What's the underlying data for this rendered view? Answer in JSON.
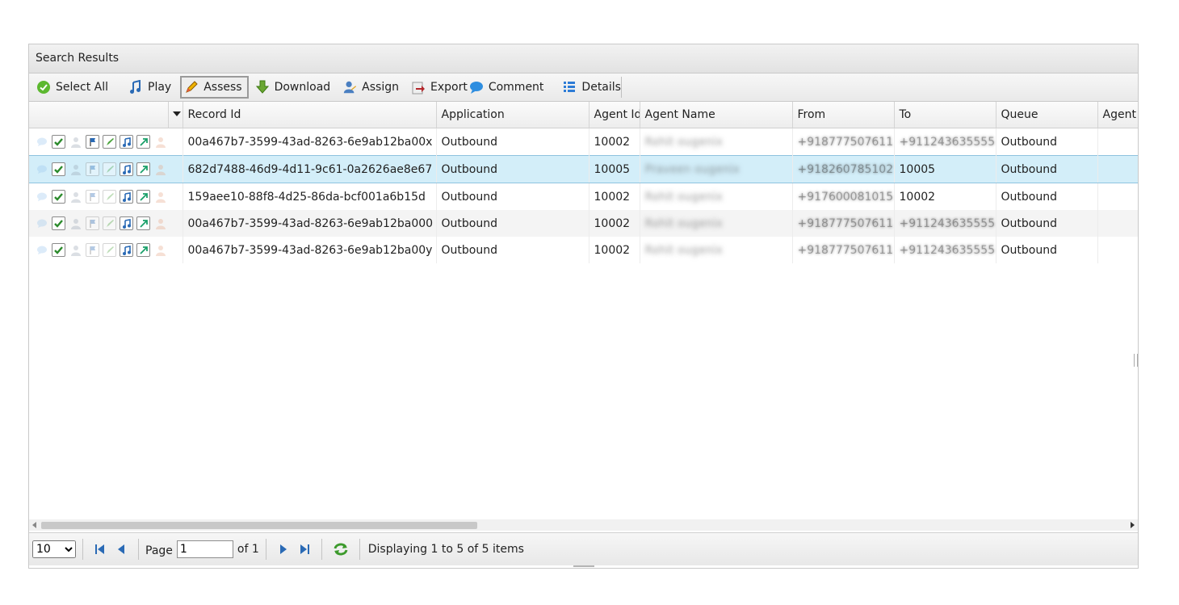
{
  "panel": {
    "title": "Search Results"
  },
  "toolbar": {
    "buttons": [
      {
        "label": "Select All",
        "icon": "check-circle-icon"
      },
      {
        "label": "Play",
        "icon": "music-note-icon"
      },
      {
        "label": "Assess",
        "icon": "pencil-icon"
      },
      {
        "label": "Download",
        "icon": "download-arrow-icon"
      },
      {
        "label": "Assign",
        "icon": "user-assign-icon"
      },
      {
        "label": "Export",
        "icon": "export-icon"
      },
      {
        "label": "Comment",
        "icon": "speech-bubble-icon"
      },
      {
        "label": "Details",
        "icon": "list-icon"
      }
    ]
  },
  "grid": {
    "columns": [
      "Record Id",
      "Application",
      "Agent Id",
      "Agent Name",
      "From",
      "To",
      "Queue",
      "Agent"
    ],
    "rows": [
      {
        "record_id": "00a467b7-3599-43ad-8263-6e9ab12ba00x",
        "application": "Outbound",
        "agent_id": "10002",
        "agent_name": "Rohit ougenix",
        "from": "+918777507611",
        "to": "+911243635555",
        "queue": "Outbound",
        "agent": ""
      },
      {
        "record_id": "682d7488-46d9-4d11-9c61-0a2626ae8e67",
        "application": "Outbound",
        "agent_id": "10005",
        "agent_name": "Praveen ougenix",
        "from": "+918260785102",
        "to": "10005",
        "queue": "Outbound",
        "agent": ""
      },
      {
        "record_id": "159aee10-88f8-4d25-86da-bcf001a6b15d",
        "application": "Outbound",
        "agent_id": "10002",
        "agent_name": "Rohit ougenix",
        "from": "+917600081015",
        "to": "10002",
        "queue": "Outbound",
        "agent": ""
      },
      {
        "record_id": "00a467b7-3599-43ad-8263-6e9ab12ba000",
        "application": "Outbound",
        "agent_id": "10002",
        "agent_name": "Rohit ougenix",
        "from": "+918777507611",
        "to": "+911243635555",
        "queue": "Outbound",
        "agent": ""
      },
      {
        "record_id": "00a467b7-3599-43ad-8263-6e9ab12ba00y",
        "application": "Outbound",
        "agent_id": "10002",
        "agent_name": "Rohit ougenix",
        "from": "+918777507611",
        "to": "+911243635555",
        "queue": "Outbound",
        "agent": ""
      }
    ]
  },
  "pager": {
    "page_size": "10",
    "page_label": "Page",
    "page_value": "1",
    "of_label": "of 1",
    "status": "Displaying 1 to 5 of 5 items"
  },
  "colors": {
    "selected_row": "#d3eef9",
    "selected_border": "#8fc3df",
    "alt_row": "#f4f4f4"
  }
}
